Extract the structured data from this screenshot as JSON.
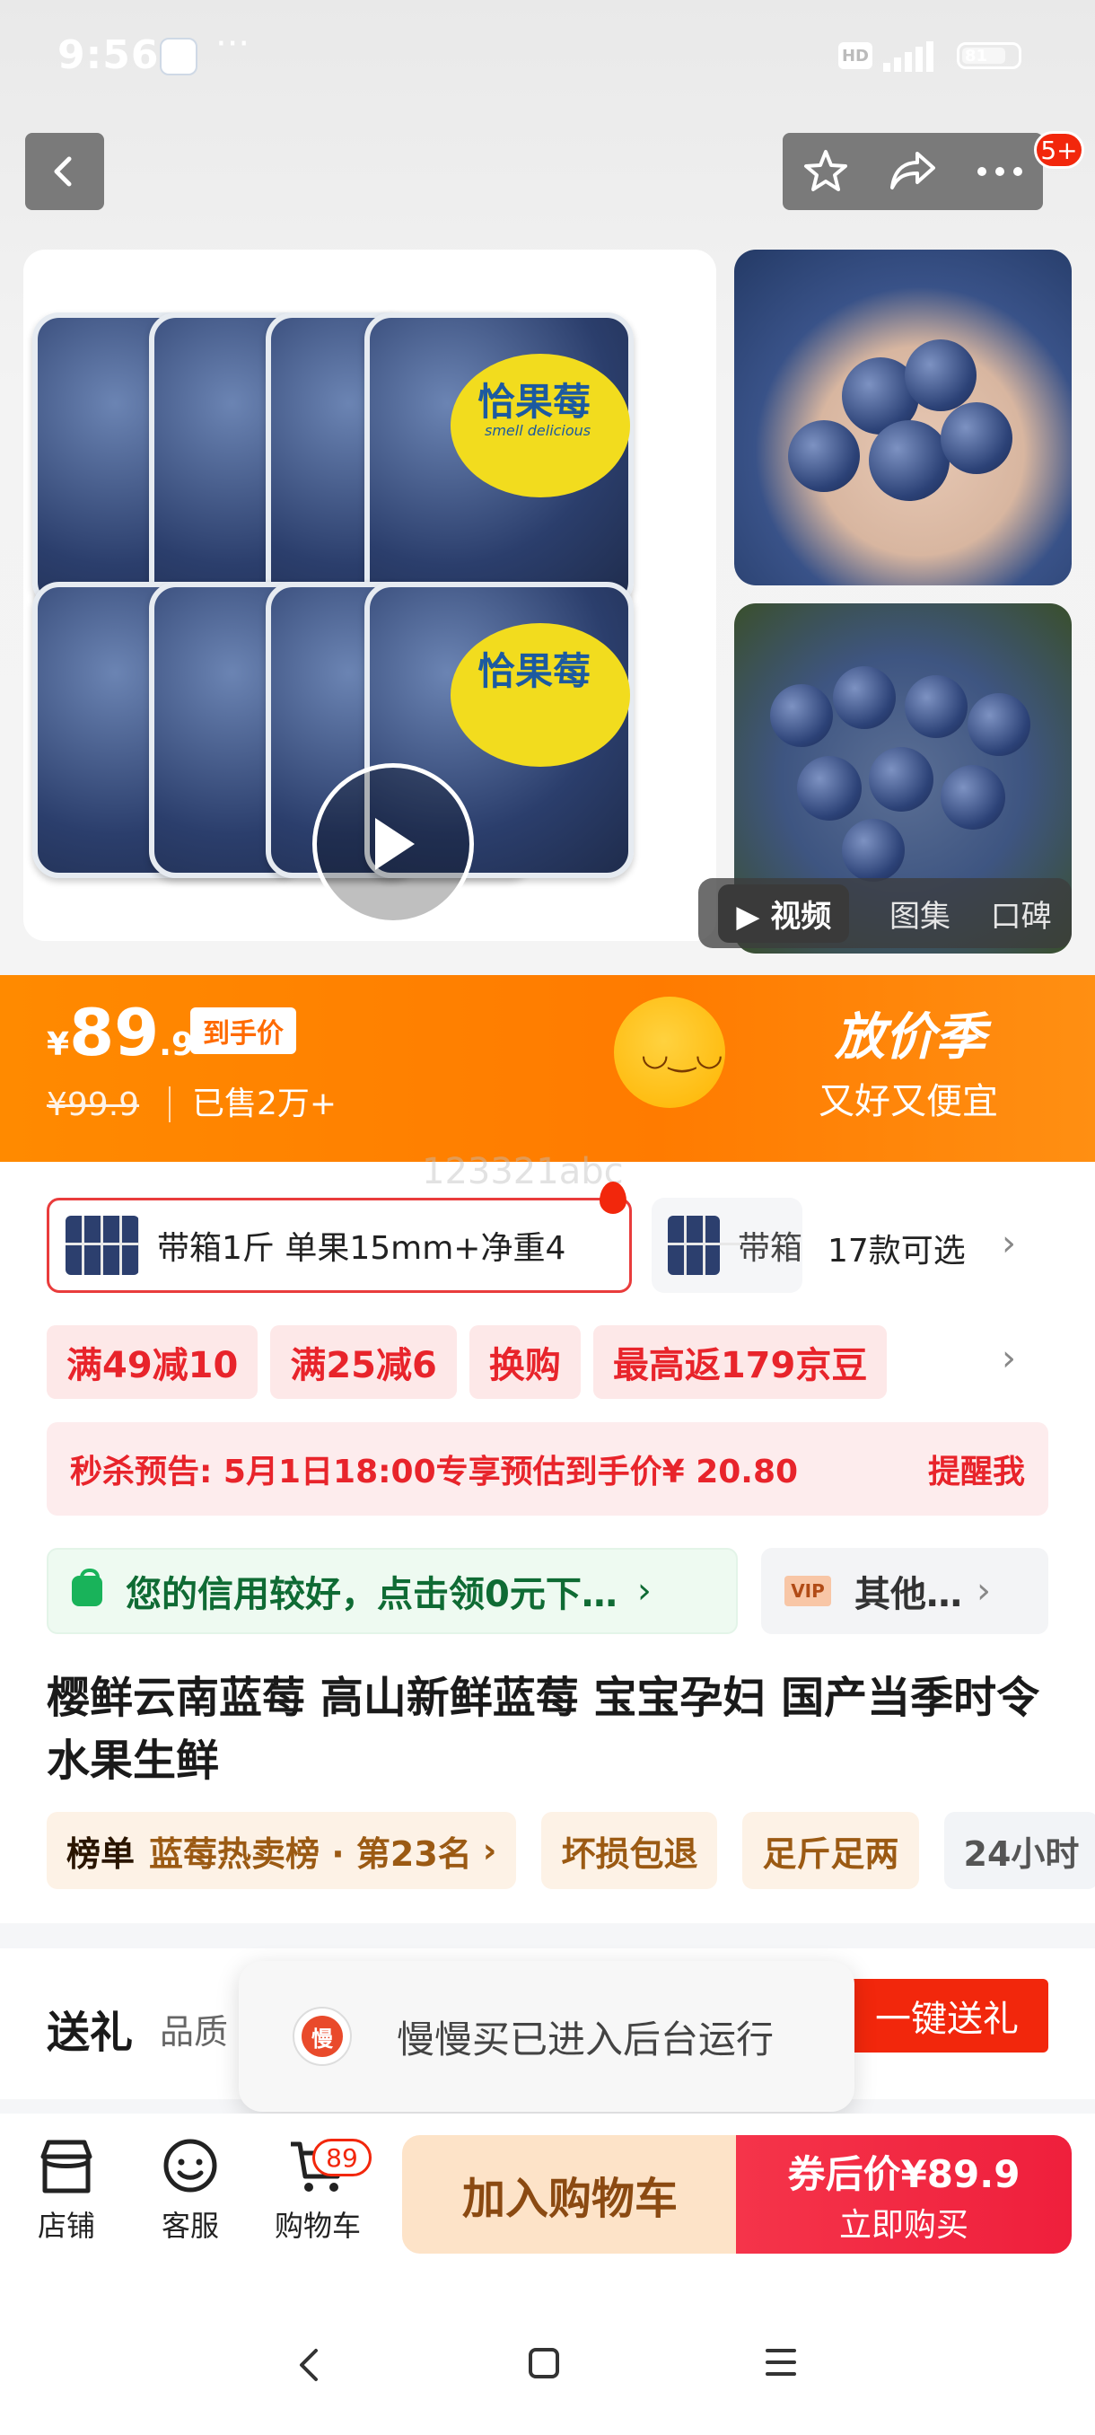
{
  "status_bar": {
    "time": "9:56",
    "more": "···",
    "hd": "HD",
    "network": "5G",
    "battery": "81"
  },
  "header": {
    "cart_badge": "5+"
  },
  "gallery": {
    "label_brand": "恰果莓",
    "label_sub": "smell delicious",
    "media_tabs": [
      "视频",
      "图集",
      "口碑"
    ]
  },
  "price": {
    "currency": "¥",
    "integer": "89",
    "decimal": ".9",
    "tag": "到手价",
    "original": "¥99.9",
    "sold": "已售2万+",
    "season_title": "放价季",
    "season_sub": "又好又便宜"
  },
  "watermark": "123321abc",
  "sku": {
    "selected": "带箱1斤 单果15mm+净重4",
    "next": "带箱",
    "count": "17款可选"
  },
  "promotions": [
    "满49减10",
    "满25减6",
    "换购",
    "最高返179京豆"
  ],
  "seckill": {
    "text": "秒杀预告: 5月1日18:00专享预估到手价¥ 20.80",
    "remind": "提醒我"
  },
  "credit": {
    "text": "您的信用较好，点击领0元下…",
    "vip_badge": "VIP",
    "vip_text": "其他…"
  },
  "product_title": "樱鲜云南蓝莓 高山新鲜蓝莓 宝宝孕妇  国产当季时令水果生鲜",
  "tags": {
    "rank_label": "榜单",
    "rank_text": "蓝莓热卖榜 · 第23名",
    "items": [
      "坏损包退",
      "足斤足两",
      "24小时"
    ]
  },
  "gift": {
    "title": "送礼",
    "sub": "品质",
    "button": "一键送礼"
  },
  "toast": {
    "icon_char": "慢",
    "text": "慢慢买已进入后台运行"
  },
  "bottom_bar": {
    "shop": "店铺",
    "service": "客服",
    "cart": "购物车",
    "cart_count": "89",
    "add_cart": "加入购物车",
    "buy_price": "券后价¥89.9",
    "buy_now": "立即购买"
  },
  "colors": {
    "accent_red": "#f2270c",
    "banner_orange": "#ff8a00",
    "credit_green": "#19b35a"
  }
}
